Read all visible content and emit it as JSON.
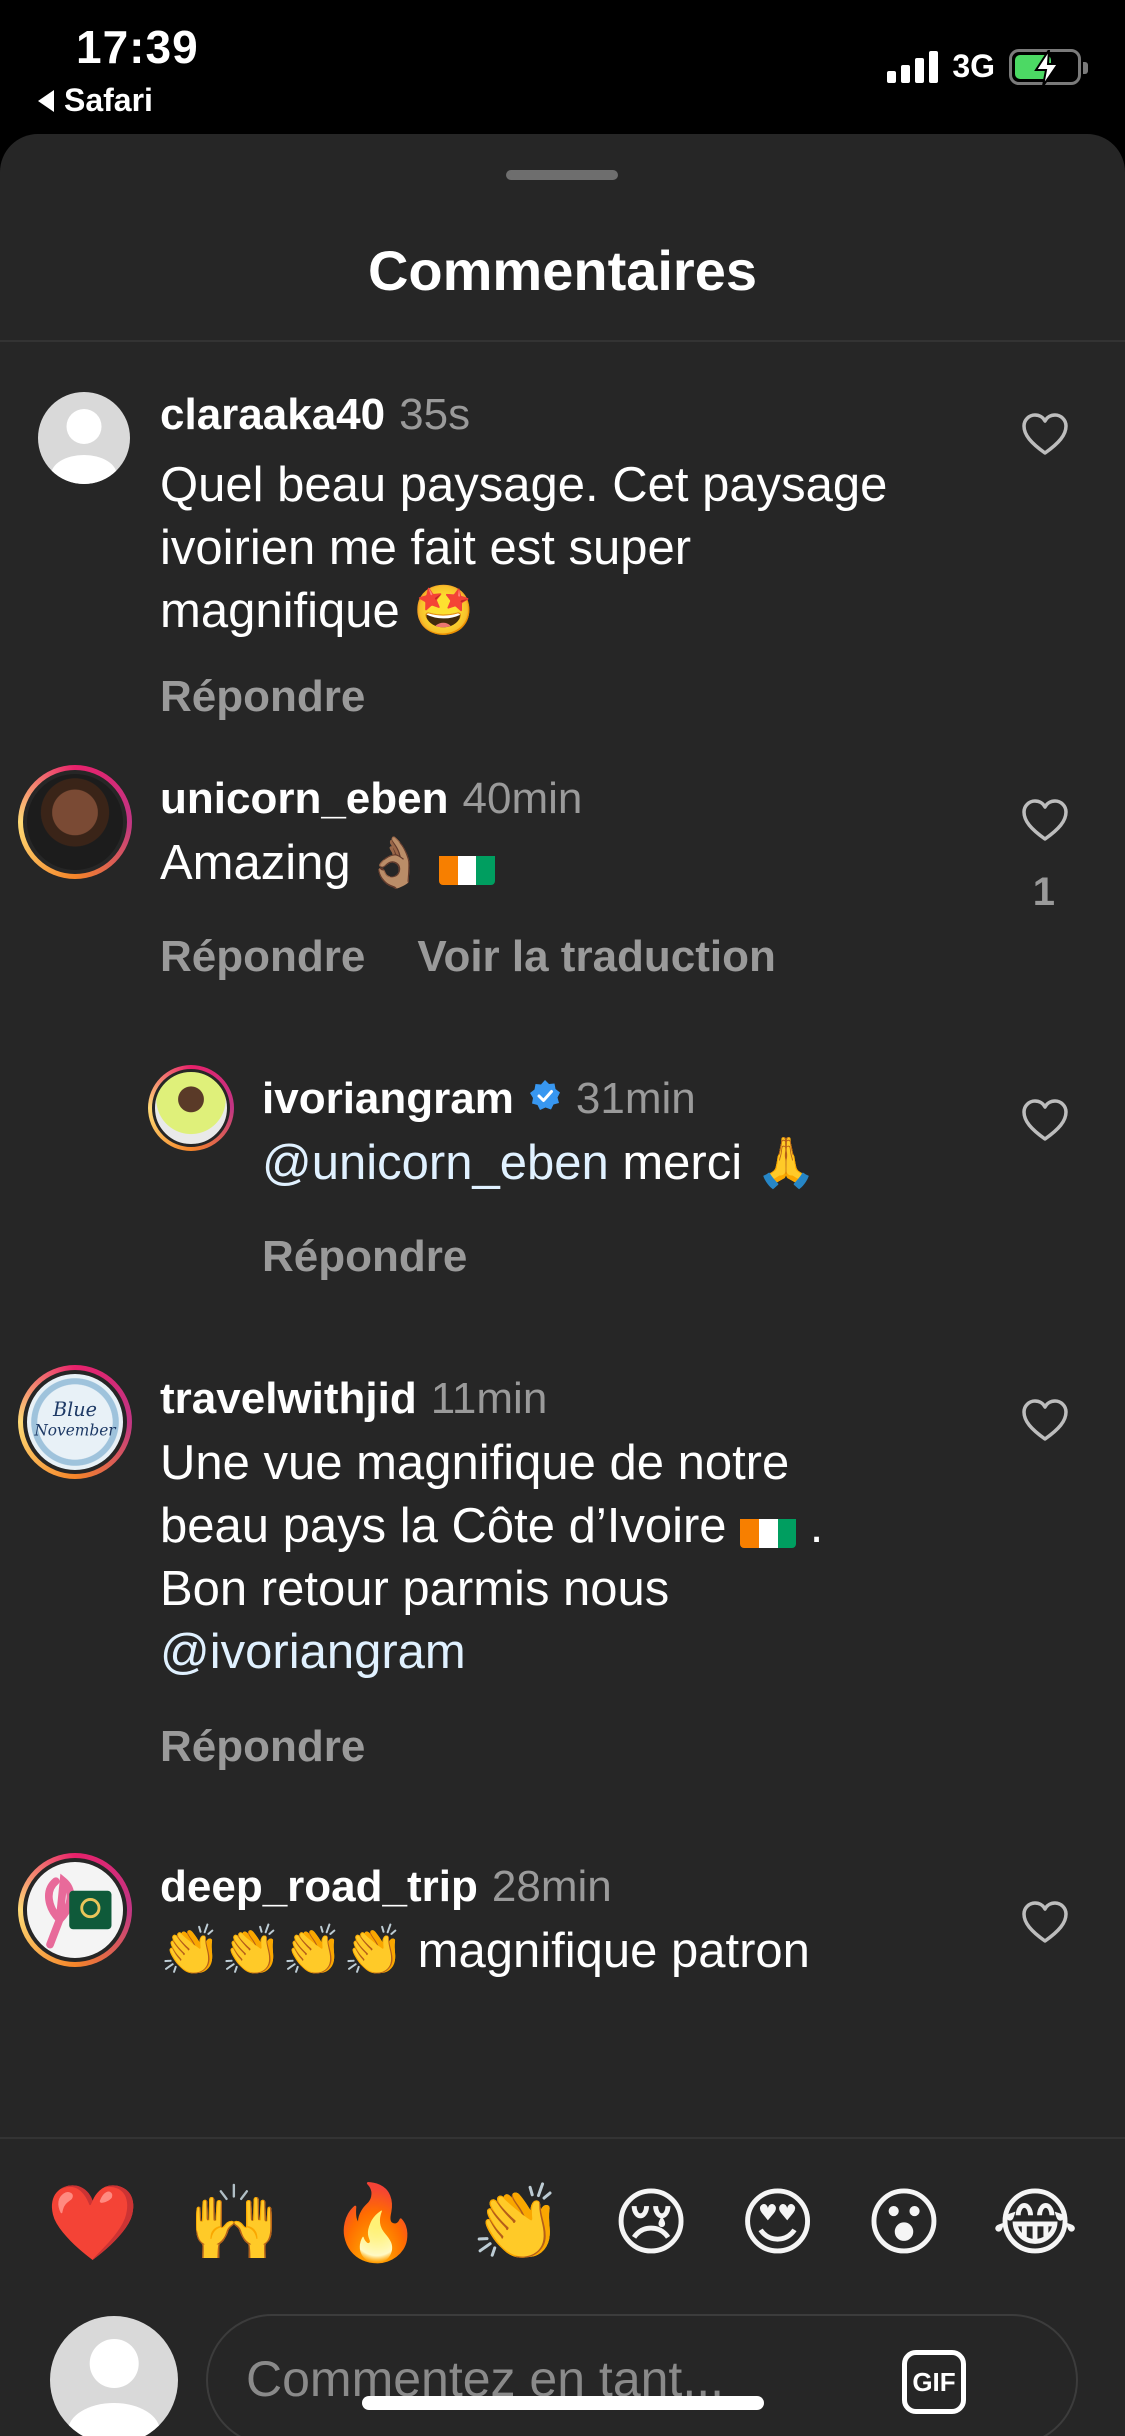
{
  "status_bar": {
    "time": "17:39",
    "back_label": "Safari",
    "network": "3G",
    "battery_level": 0.6
  },
  "sheet": {
    "title": "Commentaires"
  },
  "comments": [
    {
      "username": "claraaka40",
      "time": "35s",
      "text": "Quel beau paysage. Cet paysage ivoirien me fait est super magnifique 🤩",
      "reply_label": "Répondre"
    },
    {
      "username": "unicorn_eben",
      "time": "40min",
      "text": "Amazing 👌🏽",
      "reply_label": "Répondre",
      "translate_label": "Voir la traduction",
      "likes": "1"
    },
    {
      "username": "ivoriangram",
      "time": "31min",
      "mention": "@unicorn_eben",
      "text": " merci 🙏",
      "reply_label": "Répondre"
    },
    {
      "username": "travelwithjid",
      "time": "11min",
      "text_line1": "Une vue magnifique de notre",
      "text_line2a": "beau pays la Côte d’Ivoire ",
      "text_line2b": " .",
      "text_line3": "Bon retour parmis nous",
      "mention": "@ivoriangram",
      "reply_label": "Répondre"
    },
    {
      "username": "deep_road_trip",
      "time": "28min",
      "text": "👏👏👏👏 magnifique patron"
    }
  ],
  "reactions": [
    "❤️",
    "🙌",
    "🔥",
    "👏",
    "😢",
    "😍",
    "😮",
    "😂"
  ],
  "composer": {
    "placeholder": "Commentez en tant...",
    "gif_label": "GIF"
  },
  "icons": {
    "like": "heart-outline-icon",
    "verified": "verified-badge-icon"
  }
}
